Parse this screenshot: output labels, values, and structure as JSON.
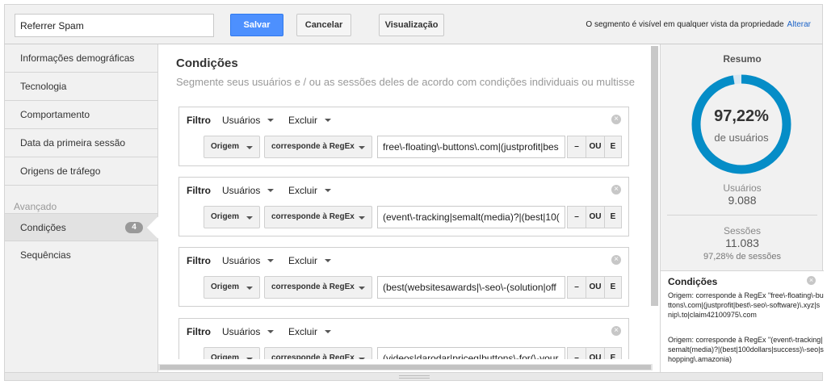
{
  "topbar": {
    "segment_name": "Referrer Spam",
    "save_label": "Salvar",
    "cancel_label": "Cancelar",
    "preview_label": "Visualização",
    "visibility_text": "O segmento é visível em qualquer vista da propriedade",
    "change_link": "Alterar"
  },
  "sidebar": {
    "items": [
      {
        "label": "Informações demográficas"
      },
      {
        "label": "Tecnologia"
      },
      {
        "label": "Comportamento"
      },
      {
        "label": "Data da primeira sessão"
      },
      {
        "label": "Origens de tráfego"
      }
    ],
    "advanced_label": "Avançado",
    "advanced_items": [
      {
        "label": "Condições",
        "badge": "4"
      },
      {
        "label": "Sequências"
      }
    ]
  },
  "main": {
    "title": "Condições",
    "subtitle": "Segmente seus usuários e / ou as sessões deles de acordo com condições individuais ou multisse",
    "filters": [
      {
        "label": "Filtro",
        "scope": "Usuários",
        "action": "Excluir",
        "dimension": "Origem",
        "operator": "corresponde à RegEx",
        "value": "free\\-floating\\-buttons\\.com|(justprofit|bes",
        "close": "×",
        "minus": "–",
        "or": "OU",
        "and": "E"
      },
      {
        "label": "Filtro",
        "scope": "Usuários",
        "action": "Excluir",
        "dimension": "Origem",
        "operator": "corresponde à RegEx",
        "value": "(event\\-tracking|semalt(media)?|(best|10(",
        "close": "×",
        "minus": "–",
        "or": "OU",
        "and": "E"
      },
      {
        "label": "Filtro",
        "scope": "Usuários",
        "action": "Excluir",
        "dimension": "Origem",
        "operator": "corresponde à RegEx",
        "value": "(best(websitesawards|\\-seo\\-(solution|off",
        "close": "×",
        "minus": "–",
        "or": "OU",
        "and": "E"
      },
      {
        "label": "Filtro",
        "scope": "Usuários",
        "action": "Excluir",
        "dimension": "Origem",
        "operator": "corresponde à RegEx",
        "value": "(videos|darodar|priceg|buttons\\-for(\\-your",
        "close": "×",
        "minus": "–",
        "or": "OU",
        "and": "E"
      }
    ]
  },
  "summary": {
    "title": "Resumo",
    "percent": "97,22%",
    "percent_value": 0.9722,
    "percent_label": "de usuários",
    "users_label": "Usuários",
    "users_value": "9.088",
    "sessions_label": "Sessões",
    "sessions_value": "11.083",
    "sessions_sub": "97,28% de sessões",
    "conditions_title": "Condições",
    "conditions_close": "×",
    "conditions": [
      "Origem: corresponde à RegEx \"free\\-floating\\-buttons\\.com|(justprofit|best\\-seo\\-software)\\.xyz|snip\\.to|claim42100975\\.com",
      "Origem: corresponde à RegEx \"(event\\-tracking|semalt(media)?|(best|100dollars|success)\\-seo|shopping\\.amazonia)"
    ]
  },
  "colors": {
    "accent": "#4d90fe",
    "donut": "#058dc7",
    "donut_track": "#d8e8f3"
  }
}
